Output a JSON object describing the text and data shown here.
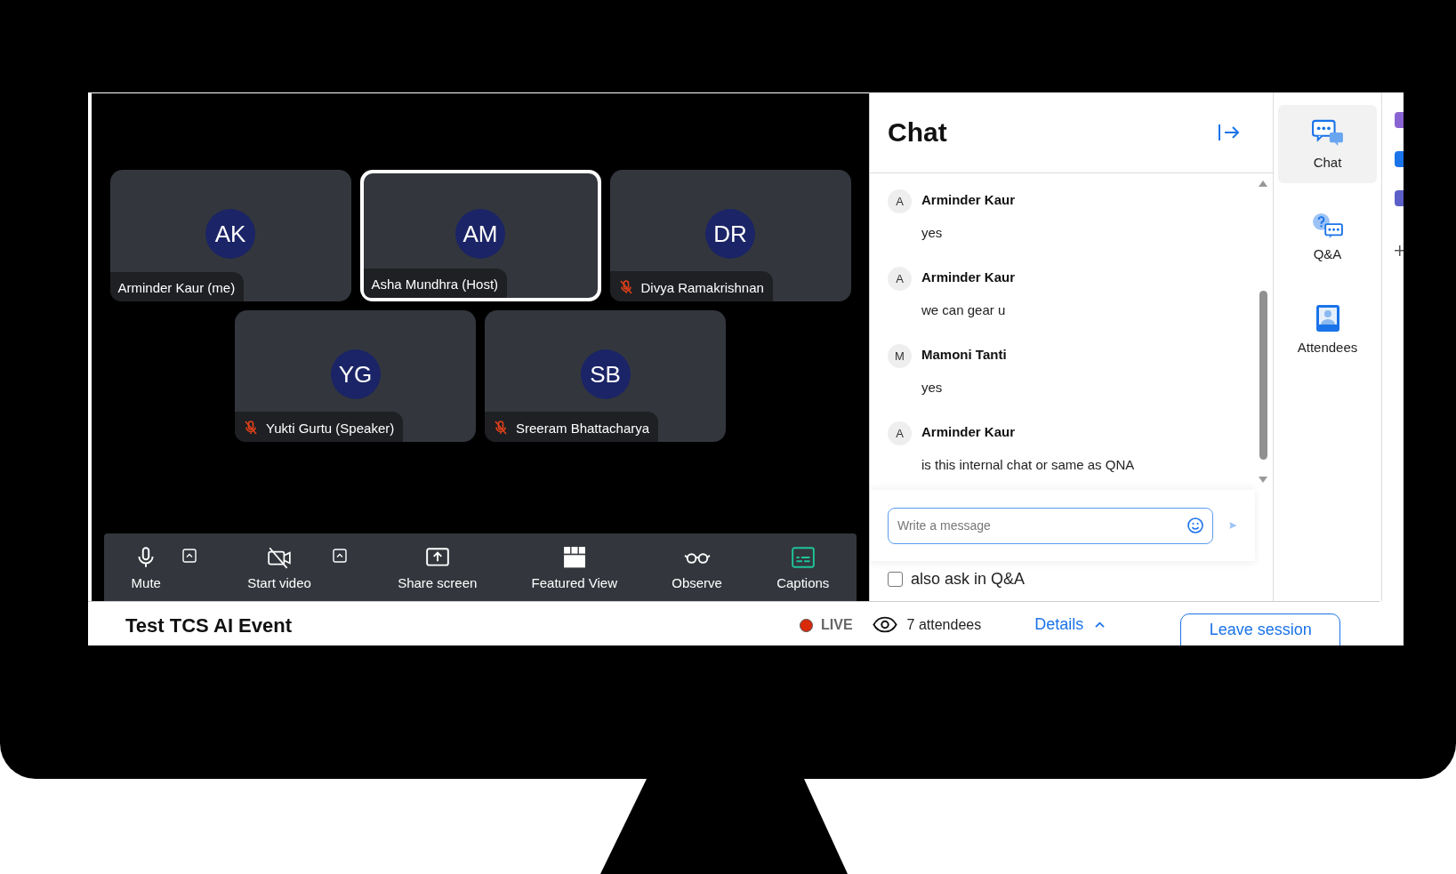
{
  "tiles": [
    {
      "initials": "AK",
      "name": "Arminder Kaur (me)",
      "muted": false,
      "selected": false
    },
    {
      "initials": "AM",
      "name": "Asha Mundhra (Host)",
      "muted": false,
      "selected": true
    },
    {
      "initials": "DR",
      "name": "Divya Ramakrishnan",
      "muted": true,
      "selected": false
    },
    {
      "initials": "YG",
      "name": "Yukti Gurtu (Speaker)",
      "muted": true,
      "selected": false
    },
    {
      "initials": "SB",
      "name": "Sreeram Bhattacharya",
      "muted": true,
      "selected": false
    }
  ],
  "toolbar": [
    {
      "kind": "mic",
      "label": "Mute",
      "dropdown": true,
      "active": false
    },
    {
      "kind": "camera-off",
      "label": "Start video",
      "dropdown": true,
      "active": false
    },
    {
      "kind": "share",
      "label": "Share screen",
      "dropdown": false,
      "active": false
    },
    {
      "kind": "grid",
      "label": "Featured View",
      "dropdown": false,
      "active": false
    },
    {
      "kind": "glasses",
      "label": "Observe",
      "dropdown": false,
      "active": false
    },
    {
      "kind": "captions",
      "label": "Captions",
      "dropdown": false,
      "active": true
    }
  ],
  "chat": {
    "title": "Chat",
    "messages": [
      {
        "initial": "A",
        "author": "Arminder Kaur",
        "text": "yes"
      },
      {
        "initial": "A",
        "author": "Arminder Kaur",
        "text": "we can gear u"
      },
      {
        "initial": "M",
        "author": "Mamoni Tanti",
        "text": "yes"
      },
      {
        "initial": "A",
        "author": "Arminder Kaur",
        "text": "is this internal chat or same as QNA"
      }
    ],
    "input": {
      "placeholder": "Write a message"
    },
    "also_ask": {
      "label": "also ask in Q&A",
      "checked": false
    }
  },
  "rail": [
    {
      "kind": "chat",
      "label": "Chat",
      "selected": true
    },
    {
      "kind": "qa",
      "label": "Q&A",
      "selected": false
    },
    {
      "kind": "attendees",
      "label": "Attendees",
      "selected": false
    }
  ],
  "footer": {
    "title": "Test TCS AI Event",
    "live": "LIVE",
    "attendees": "7 attendees",
    "details": "Details",
    "leave": "Leave session"
  }
}
